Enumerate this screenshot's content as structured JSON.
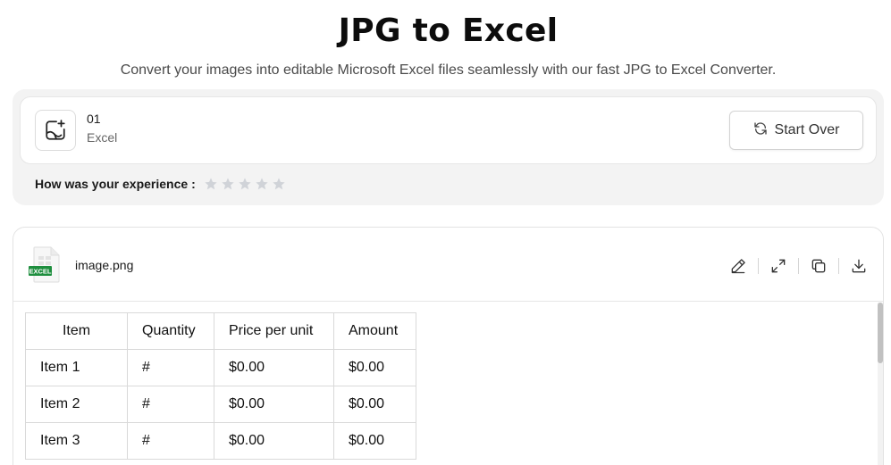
{
  "page": {
    "title": "JPG to Excel",
    "subtitle": "Convert your images into editable Microsoft Excel files seamlessly with our fast JPG to Excel Converter."
  },
  "summary": {
    "file_count": "01",
    "file_format": "Excel",
    "start_over_label": "Start Over",
    "upload_icon": "image-plus-icon",
    "refresh_icon": "refresh-icon"
  },
  "rating": {
    "label": "How was your experience :",
    "stars": 5,
    "selected": 0,
    "star_color": "#d0d3d8"
  },
  "preview": {
    "file_name": "image.png",
    "file_badge": "EXCEL",
    "badge_color": "#1e8e3e",
    "actions": [
      "edit-icon",
      "expand-icon",
      "copy-icon",
      "download-icon"
    ]
  },
  "table": {
    "headers": [
      "Item",
      "Quantity",
      "Price per unit",
      "Amount"
    ],
    "rows": [
      [
        "Item 1",
        "#",
        "$0.00",
        "$0.00"
      ],
      [
        "Item 2",
        "#",
        "$0.00",
        "$0.00"
      ],
      [
        "Item 3",
        "#",
        "$0.00",
        "$0.00"
      ]
    ]
  }
}
